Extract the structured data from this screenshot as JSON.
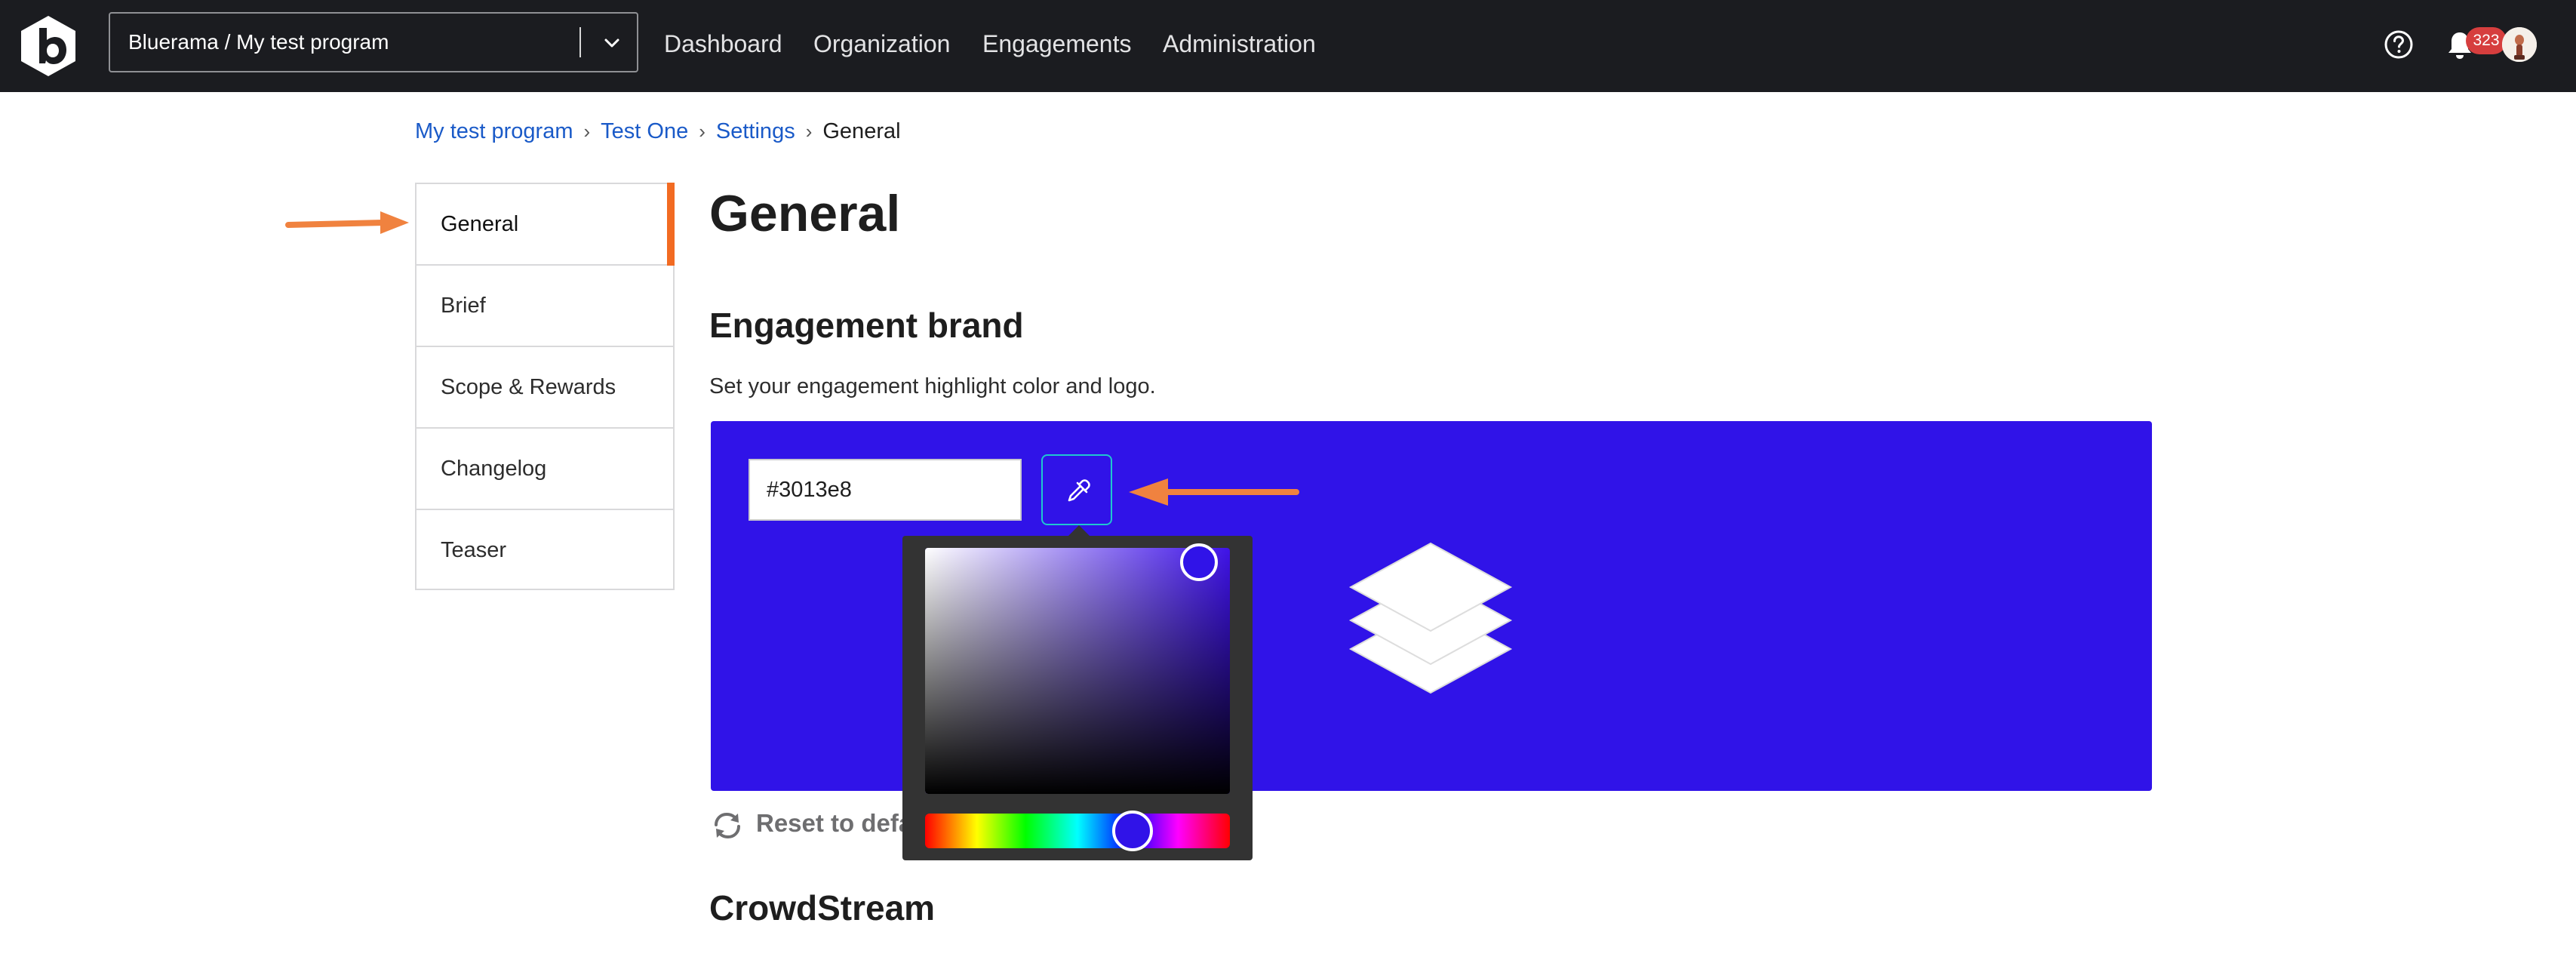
{
  "topbar": {
    "program_selector": "Bluerama / My test program",
    "nav": [
      "Dashboard",
      "Organization",
      "Engagements",
      "Administration"
    ],
    "notification_count": "323"
  },
  "breadcrumb": [
    "My test program",
    "Test One",
    "Settings",
    "General"
  ],
  "sidemenu": {
    "items": [
      "General",
      "Brief",
      "Scope & Rewards",
      "Changelog",
      "Teaser"
    ],
    "active": "General"
  },
  "main": {
    "page_title": "General",
    "brand": {
      "title": "Engagement brand",
      "description": "Set your engagement highlight color and logo.",
      "color_value": "#3013e8",
      "reset_label": "Reset to default"
    },
    "crowdstream_title": "CrowdStream"
  },
  "colors": {
    "topbar": "#1b1c20",
    "link": "#1a5ac8",
    "accent": "#f26b22",
    "brand": "#3013e8",
    "badge": "#d63e3e"
  },
  "icons": [
    "bugcrowd-logo-icon",
    "chevron-down-icon",
    "help-icon",
    "bell-icon",
    "eyedropper-icon",
    "layers-icon",
    "refresh-icon",
    "arrow-icon"
  ]
}
